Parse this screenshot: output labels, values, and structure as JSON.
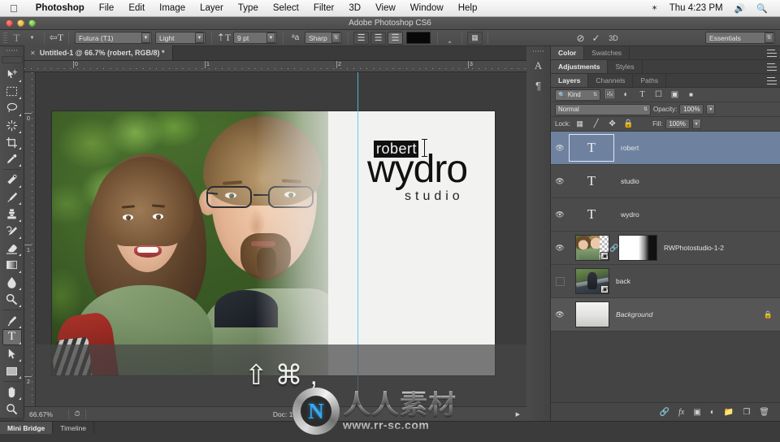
{
  "os_menubar": {
    "apple_icon": "apple-icon",
    "items": [
      "Photoshop",
      "File",
      "Edit",
      "Image",
      "Layer",
      "Type",
      "Select",
      "Filter",
      "3D",
      "View",
      "Window",
      "Help"
    ],
    "app_item": "Photoshop",
    "right": {
      "spotlight_extra_icon": "bluetooth-icon",
      "clock": "Thu 4:23 PM",
      "volume_icon": "volume-icon",
      "search_icon": "search-icon"
    }
  },
  "titlebar": {
    "title": "Adobe Photoshop CS6"
  },
  "options_bar": {
    "tool_icon": "type-tool-icon",
    "orientation_icon": "text-orientation-icon",
    "font_family": "Futura (T1)",
    "font_style": "Light",
    "size_icon": "font-size-icon",
    "font_size": "9 pt",
    "antialias_icon": "anti-alias-icon",
    "antialias": "Sharp",
    "align_left_icon": "align-left-icon",
    "align_center_icon": "align-center-icon",
    "align_right_icon": "align-right-icon",
    "color_swatch": "#080808",
    "warp_icon": "warp-text-icon",
    "panels_icon": "character-paragraph-panels-icon",
    "cancel_icon": "cancel-edit-icon",
    "commit_icon": "commit-edit-icon",
    "threed_label": "3D",
    "workspace": "Essentials"
  },
  "document": {
    "tab_title": "Untitled-1 @ 66.7% (robert, RGB/8) *",
    "close_icon": "close-tab-icon",
    "ruler_marks": [
      "0",
      "1",
      "2",
      "3"
    ],
    "ruler_marks_v": [
      "0",
      "1",
      "2"
    ]
  },
  "artwork": {
    "logo_line1": "robert",
    "logo_line2": "wydro",
    "logo_line3": "studio"
  },
  "keyboard_overlay": {
    "keys": [
      "⇧",
      "⌘",
      ","
    ]
  },
  "status_bar": {
    "zoom": "66.67%",
    "clock_icon": "timing-icon",
    "doc_info": "Doc: 1.99M/11.6M",
    "arrow_icon": "status-menu-arrow-icon"
  },
  "bottom_tabs": [
    {
      "label": "Mini Bridge",
      "active": true
    },
    {
      "label": "Timeline",
      "active": false
    }
  ],
  "dock_strip": {
    "character_icon": "character-panel-icon",
    "paragraph_icon": "paragraph-panel-icon"
  },
  "panels": {
    "group1": {
      "tabs": [
        {
          "label": "Color",
          "active": true
        },
        {
          "label": "Swatches",
          "active": false
        }
      ]
    },
    "group2": {
      "tabs": [
        {
          "label": "Adjustments",
          "active": true
        },
        {
          "label": "Styles",
          "active": false
        }
      ]
    },
    "group3": {
      "tabs": [
        {
          "label": "Layers",
          "active": true
        },
        {
          "label": "Channels",
          "active": false
        },
        {
          "label": "Paths",
          "active": false
        }
      ]
    },
    "menu_icon": "panel-menu-icon"
  },
  "layers_panel": {
    "filter": {
      "search_icon": "filter-search-icon",
      "kind_label": "Kind",
      "pixel_icon": "pixel-layer-filter-icon",
      "adjustment_icon": "adjustment-layer-filter-icon",
      "type_icon": "type-layer-filter-icon",
      "shape_icon": "shape-layer-filter-icon",
      "smart_icon": "smart-object-filter-icon",
      "toggle_icon": "filter-toggle-icon"
    },
    "blend_mode": "Normal",
    "opacity_label": "Opacity:",
    "opacity_value": "100%",
    "lock_label": "Lock:",
    "lock_transparent_icon": "lock-transparent-pixels-icon",
    "lock_image_icon": "lock-image-pixels-icon",
    "lock_position_icon": "lock-position-icon",
    "lock_all_icon": "lock-all-icon",
    "fill_label": "Fill:",
    "fill_value": "100%",
    "rows": [
      {
        "name": "robert",
        "kind": "type",
        "visible": true,
        "selected": true,
        "locked": false
      },
      {
        "name": "studio",
        "kind": "type",
        "visible": true,
        "selected": false,
        "locked": false
      },
      {
        "name": "wydro",
        "kind": "type",
        "visible": true,
        "selected": false,
        "locked": false
      },
      {
        "name": "RWPhotostudio-1-2",
        "kind": "smart-mask",
        "visible": true,
        "selected": false,
        "locked": false
      },
      {
        "name": "back",
        "kind": "smart",
        "visible": false,
        "selected": false,
        "locked": false
      },
      {
        "name": "Background",
        "kind": "background",
        "visible": true,
        "selected": false,
        "locked": true
      }
    ],
    "footer_icons": [
      "link-layers-icon",
      "layer-style-fx-icon",
      "add-mask-icon",
      "adjustment-layer-icon",
      "new-group-icon",
      "new-layer-icon",
      "delete-layer-icon"
    ],
    "footer_fx_label": "fx"
  },
  "watermark": {
    "logo_letter": "N",
    "chinese": "人人素材",
    "url": "www.rr-sc.com"
  }
}
